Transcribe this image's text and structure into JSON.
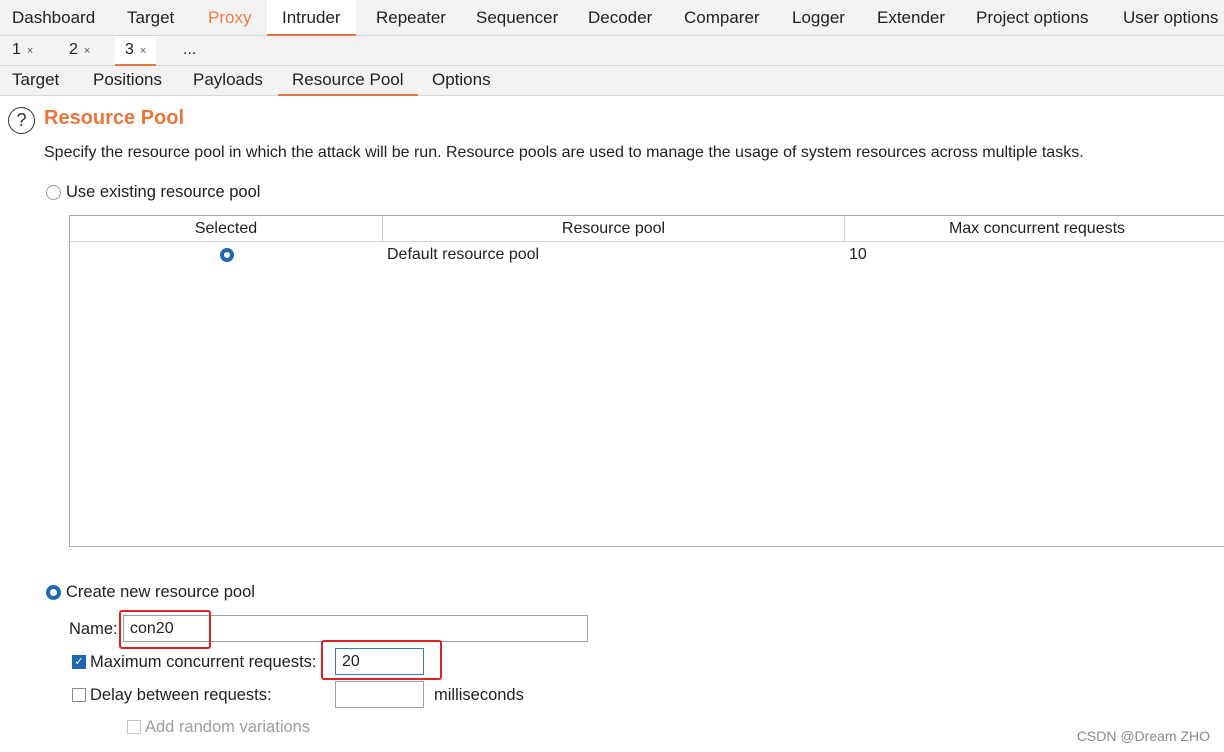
{
  "main_tabs": [
    "Dashboard",
    "Target",
    "Proxy",
    "Intruder",
    "Repeater",
    "Sequencer",
    "Decoder",
    "Comparer",
    "Logger",
    "Extender",
    "Project options",
    "User options"
  ],
  "instance_tabs": [
    "1",
    "2",
    "3",
    "..."
  ],
  "close_glyph": "×",
  "sub_tabs": [
    "Target",
    "Positions",
    "Payloads",
    "Resource Pool",
    "Options"
  ],
  "section": {
    "help_glyph": "?",
    "title": "Resource Pool",
    "description": "Specify the resource pool in which the attack will be run. Resource pools are used to manage the usage of system resources across multiple tasks."
  },
  "existing_pool": {
    "label": "Use existing resource pool",
    "selected": false,
    "columns": [
      "Selected",
      "Resource pool",
      "Max concurrent requests"
    ],
    "rows": [
      {
        "selected": true,
        "name": "Default resource pool",
        "max": "10"
      }
    ]
  },
  "new_pool": {
    "label": "Create new resource pool",
    "selected": true,
    "name_label": "Name:",
    "name_value": "con20",
    "max_label": "Maximum concurrent requests:",
    "max_checked": true,
    "max_value": "20",
    "delay_label": "Delay between requests:",
    "delay_checked": false,
    "delay_value": "",
    "delay_unit": "milliseconds",
    "random_label": "Add random variations",
    "random_checked": false
  },
  "watermark": "CSDN @Dream ZHO",
  "colors": {
    "accent": "#e8763a",
    "selection": "#1f67b1",
    "highlight_box": "#e02020"
  }
}
